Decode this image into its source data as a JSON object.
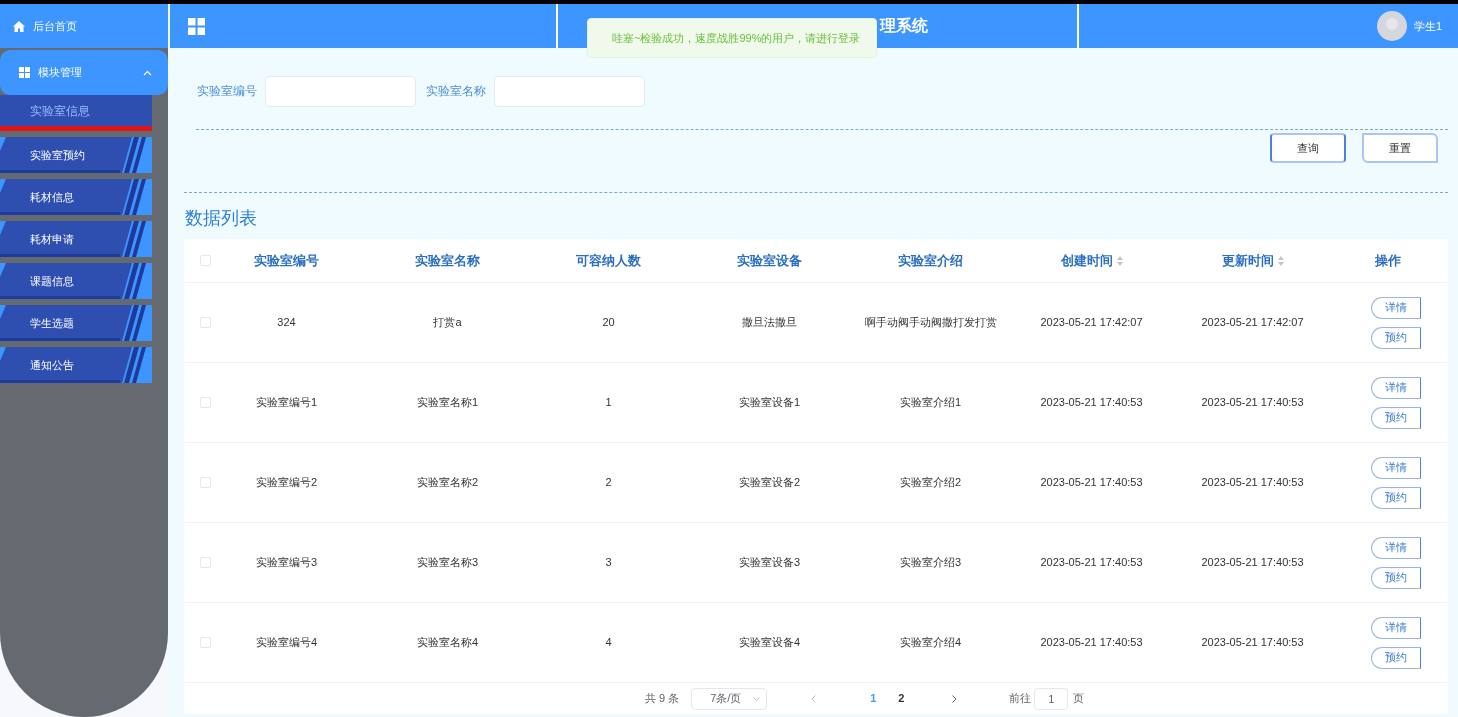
{
  "sidebar": {
    "home": "后台首页",
    "group": {
      "label": "模块管理",
      "expanded": true
    },
    "items": [
      {
        "label": "实验室信息",
        "selected": true
      },
      {
        "label": "实验室预约",
        "selected": false
      },
      {
        "label": "耗材信息",
        "selected": false
      },
      {
        "label": "耗材申请",
        "selected": false
      },
      {
        "label": "课题信息",
        "selected": false
      },
      {
        "label": "学生选题",
        "selected": false
      },
      {
        "label": "通知公告",
        "selected": false
      }
    ]
  },
  "header": {
    "title_visible": "理系统",
    "user": "学生1"
  },
  "toast": {
    "message": "哇塞~检验成功，速度战胜99%的用户，请进行登录"
  },
  "search": {
    "fields": [
      {
        "label": "实验室编号"
      },
      {
        "label": "实验室名称"
      }
    ],
    "buttons": [
      "查询",
      "重置"
    ]
  },
  "section_title": "数据列表",
  "table": {
    "all_checked": false,
    "columns": [
      {
        "label": "实验室编号",
        "sortable": false
      },
      {
        "label": "实验室名称",
        "sortable": false
      },
      {
        "label": "可容纳人数",
        "sortable": false
      },
      {
        "label": "实验室设备",
        "sortable": false
      },
      {
        "label": "实验室介绍",
        "sortable": false
      },
      {
        "label": "创建时间",
        "sortable": true
      },
      {
        "label": "更新时间",
        "sortable": true
      },
      {
        "label": "操作",
        "sortable": false
      }
    ],
    "rows": [
      {
        "checked": false,
        "cells": [
          "324",
          "打赏a",
          "20",
          "撒旦法撒旦",
          "啊手动阀手动阀撒打发打赏",
          "2023-05-21 17:42:07",
          "2023-05-21 17:42:07"
        ],
        "actions": [
          "详情",
          "预约"
        ]
      },
      {
        "checked": false,
        "cells": [
          "实验室编号1",
          "实验室名称1",
          "1",
          "实验室设备1",
          "实验室介绍1",
          "2023-05-21 17:40:53",
          "2023-05-21 17:40:53"
        ],
        "actions": [
          "详情",
          "预约"
        ]
      },
      {
        "checked": false,
        "cells": [
          "实验室编号2",
          "实验室名称2",
          "2",
          "实验室设备2",
          "实验室介绍2",
          "2023-05-21 17:40:53",
          "2023-05-21 17:40:53"
        ],
        "actions": [
          "详情",
          "预约"
        ]
      },
      {
        "checked": false,
        "cells": [
          "实验室编号3",
          "实验室名称3",
          "3",
          "实验室设备3",
          "实验室介绍3",
          "2023-05-21 17:40:53",
          "2023-05-21 17:40:53"
        ],
        "actions": [
          "详情",
          "预约"
        ]
      },
      {
        "checked": false,
        "cells": [
          "实验室编号4",
          "实验室名称4",
          "4",
          "实验室设备4",
          "实验室介绍4",
          "2023-05-21 17:40:53",
          "2023-05-21 17:40:53"
        ],
        "actions": [
          "详情",
          "预约"
        ]
      }
    ]
  },
  "pagination": {
    "total": "共 9 条",
    "page_size": "7条/页",
    "pages": [
      {
        "label": "1",
        "selected": true
      },
      {
        "label": "2",
        "selected": false
      }
    ],
    "goto_label": "前往",
    "goto_value": "1",
    "goto_suffix": "页"
  }
}
